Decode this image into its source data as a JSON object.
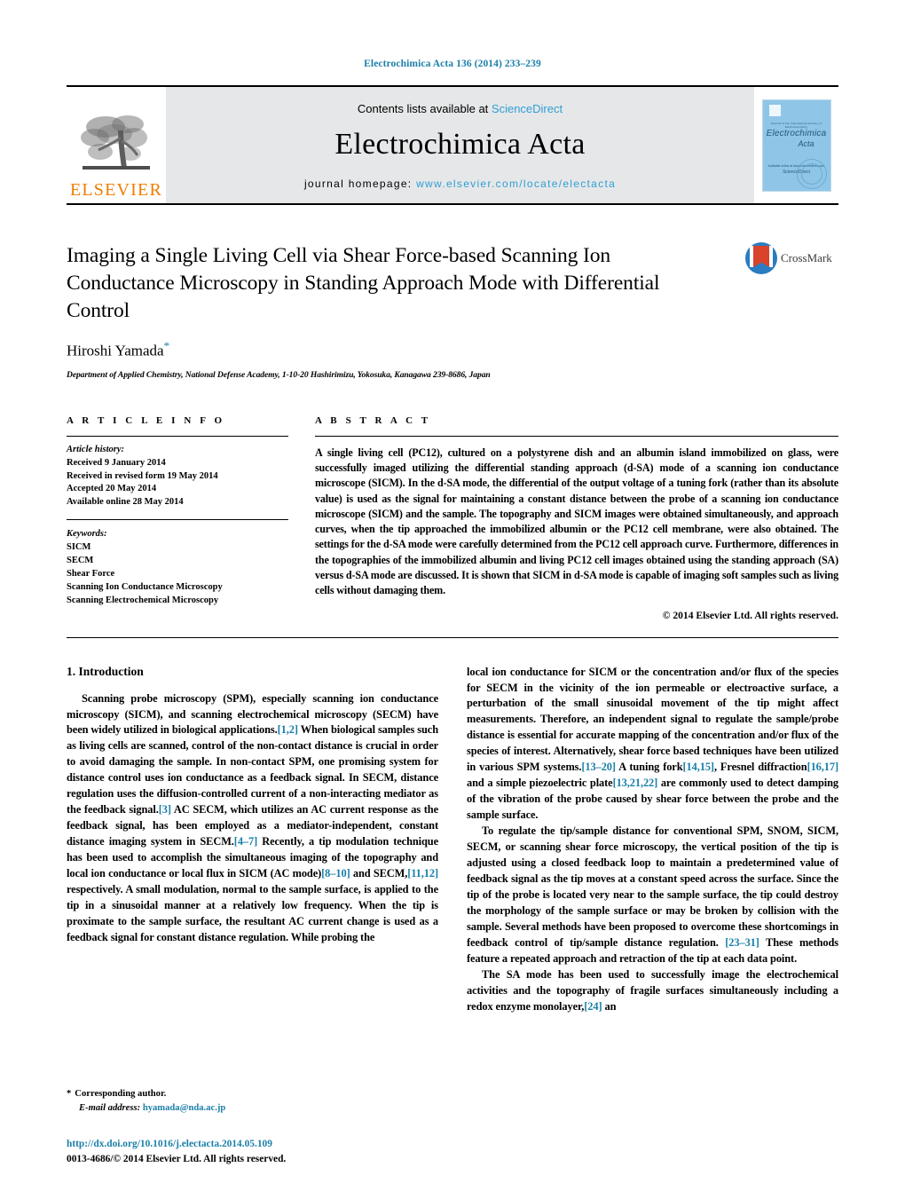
{
  "running_head": "Electrochimica Acta 136 (2014) 233–239",
  "masthead": {
    "publisher_name": "ELSEVIER",
    "publisher_logo_name": "elsevier-tree-logo",
    "contents_prefix": "Contents lists available at ",
    "contents_link": "ScienceDirect",
    "journal_title": "Electrochimica Acta",
    "homepage_prefix": "journal homepage: ",
    "homepage_url": "www.elsevier.com/locate/electacta",
    "cover": {
      "line1": "Journal of the International Society of Electrochemistry",
      "line2": "Electrochimica",
      "line3": "Acta",
      "sd_small": "Available online at www.sciencedirect.com",
      "sd_brand": "ScienceDirect"
    },
    "accent_link_color": "#2e9fd4",
    "band_color": "#e6e7e8",
    "brand_orange": "#F07C00"
  },
  "article": {
    "title": "Imaging a Single Living Cell via Shear Force-based Scanning Ion Conductance Microscopy in Standing Approach Mode with Differential Control",
    "author": "Hiroshi Yamada",
    "author_marker": "*",
    "affiliation": "Department of Applied Chemistry, National Defense Academy, 1-10-20 Hashirimizu, Yokosuka, Kanagawa 239-8686, Japan",
    "crossmark_label": "CrossMark"
  },
  "article_info": {
    "heading": "A R T I C L E   I N F O",
    "history_label": "Article history:",
    "history": [
      "Received 9 January 2014",
      "Received in revised form 19 May 2014",
      "Accepted 20 May 2014",
      "Available online 28 May 2014"
    ],
    "keywords_label": "Keywords:",
    "keywords": [
      "SICM",
      "SECM",
      "Shear Force",
      "Scanning Ion Conductance Microscopy",
      "Scanning Electrochemical Microscopy"
    ]
  },
  "abstract": {
    "heading": "A B S T R A C T",
    "text": "A single living cell (PC12), cultured on a polystyrene dish and an albumin island immobilized on glass, were successfully imaged utilizing the differential standing approach (d-SA) mode of a scanning ion conductance microscope (SICM). In the d-SA mode, the differential of the output voltage of a tuning fork (rather than its absolute value) is used as the signal for maintaining a constant distance between the probe of a scanning ion conductance microscope (SICM) and the sample. The topography and SICM images were obtained simultaneously, and approach curves, when the tip approached the immobilized albumin or the PC12 cell membrane, were also obtained. The settings for the d-SA mode were carefully determined from the PC12 cell approach curve. Furthermore, differences in the topographies of the immobilized albumin and living PC12 cell images obtained using the standing approach (SA) versus d-SA mode are discussed. It is shown that SICM in d-SA mode is capable of imaging soft samples such as living cells without damaging them.",
    "copyright": "© 2014 Elsevier Ltd. All rights reserved."
  },
  "body": {
    "section_number_title": "1.  Introduction",
    "left_paragraphs": [
      "Scanning probe microscopy (SPM), especially scanning ion conductance microscopy (SICM), and scanning electrochemical microscopy (SECM) have been widely utilized in biological applications.[1,2] When biological samples such as living cells are scanned, control of the non-contact distance is crucial in order to avoid damaging the sample. In non-contact SPM, one promising system for distance control uses ion conductance as a feedback signal. In SECM, distance regulation uses the diffusion-controlled current of a non-interacting mediator as the feedback signal.[3] AC SECM, which utilizes an AC current response as the feedback signal, has been employed as a mediator-independent, constant distance imaging system in SECM.[4–7] Recently, a tip modulation technique has been used to accomplish the simultaneous imaging of the topography and local ion conductance or local flux in SICM (AC mode)[8–10] and SECM,[11,12] respectively. A small modulation, normal to the sample surface, is applied to the tip in a sinusoidal manner at a relatively low frequency. When the tip is proximate to the sample surface, the resultant AC current change is used as a feedback signal for constant distance regulation. While probing the"
    ],
    "right_paragraphs": [
      "local ion conductance for SICM or the concentration and/or flux of the species for SECM in the vicinity of the ion permeable or electroactive surface, a perturbation of the small sinusoidal movement of the tip might affect measurements. Therefore, an independent signal to regulate the sample/probe distance is essential for accurate mapping of the concentration and/or flux of the species of interest. Alternatively, shear force based techniques have been utilized in various SPM systems.[13–20] A tuning fork[14,15], Fresnel diffraction[16,17] and a simple piezoelectric plate[13,21,22] are commonly used to detect damping of the vibration of the probe caused by shear force between the probe and the sample surface.",
      "To regulate the tip/sample distance for conventional SPM, SNOM, SICM, SECM, or scanning shear force microscopy, the vertical position of the tip is adjusted using a closed feedback loop to maintain a predetermined value of feedback signal as the tip moves at a constant speed across the surface. Since the tip of the probe is located very near to the sample surface, the tip could destroy the morphology of the sample surface or may be broken by collision with the sample. Several methods have been proposed to overcome these shortcomings in feedback control of tip/sample distance regulation. [23–31] These methods feature a repeated approach and retraction of the tip at each data point.",
      "The SA mode has been used to successfully image the electrochemical activities and the topography of fragile surfaces simultaneously including a redox enzyme monolayer,[24] an"
    ]
  },
  "footer": {
    "corresponding_marker": "*",
    "corresponding_label": "Corresponding author.",
    "email_label": "E-mail address:",
    "email": "hyamada@nda.ac.jp",
    "doi_url": "http://dx.doi.org/10.1016/j.electacta.2014.05.109",
    "issn_line": "0013-4686/© 2014 Elsevier Ltd. All rights reserved."
  },
  "colors": {
    "link_blue": "#1a7fa8",
    "sciencedirect_blue": "#2e9fd4",
    "elsevier_orange": "#F07C00"
  }
}
